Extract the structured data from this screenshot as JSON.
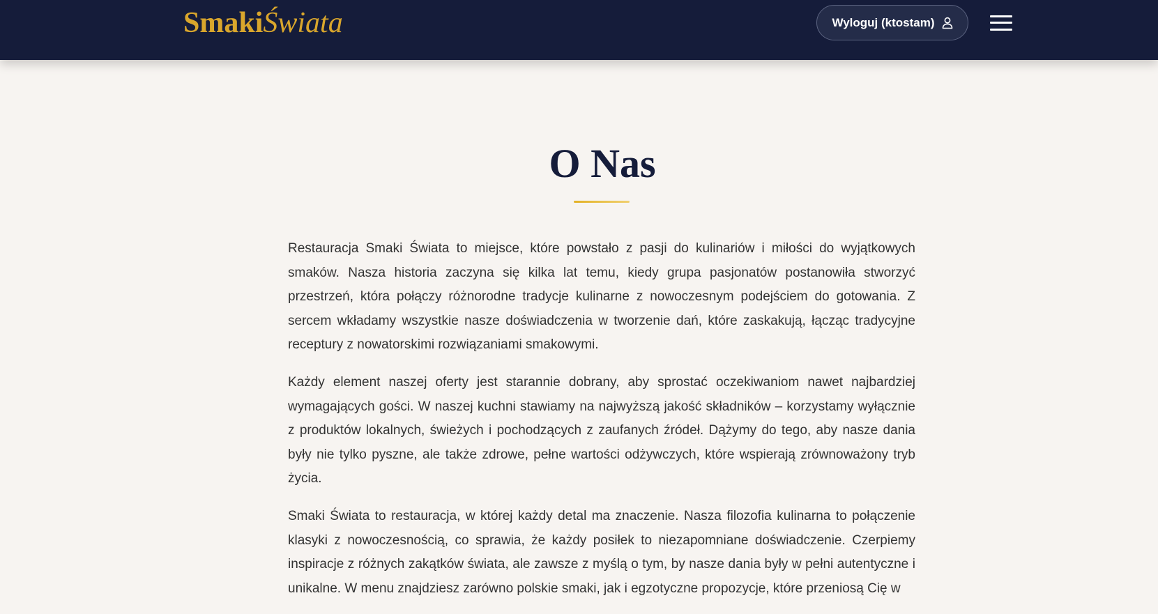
{
  "header": {
    "logo_main": "Smaki",
    "logo_accent": "Świata",
    "logout_label": "Wyloguj (ktostam)",
    "logout_icon": "user-icon",
    "menu_icon": "hamburger-menu-icon",
    "background_color": "#151c3a",
    "accent_color": "#d9a62c"
  },
  "main": {
    "title": "O Nas",
    "paragraphs": [
      "Restauracja Smaki Świata to miejsce, które powstało z pasji do kulinariów i miłości do wyjątkowych smaków. Nasza historia zaczyna się kilka lat temu, kiedy grupa pasjonatów postanowiła stworzyć przestrzeń, która połączy różnorodne tradycje kulinarne z nowoczesnym podejściem do gotowania. Z sercem wkładamy wszystkie nasze doświadczenia w tworzenie dań, które zaskakują, łącząc tradycyjne receptury z nowatorskimi rozwiązaniami smakowymi.",
      "Każdy element naszej oferty jest starannie dobrany, aby sprostać oczekiwaniom nawet najbardziej wymagających gości. W naszej kuchni stawiamy na najwyższą jakość składników – korzystamy wyłącznie z produktów lokalnych, świeżych i pochodzących z zaufanych źródeł. Dążymy do tego, aby nasze dania były nie tylko pyszne, ale także zdrowe, pełne wartości odżywczych, które wspierają zrównoważony tryb życia.",
      "Smaki Świata to restauracja, w której każdy detal ma znaczenie. Nasza filozofia kulinarna to połączenie klasyki z nowoczesnością, co sprawia, że każdy posiłek to niezapomniane doświadczenie. Czerpiemy inspiracje z różnych zakątków świata, ale zawsze z myślą o tym, by nasze dania były w pełni autentyczne i unikalne. W menu znajdziesz zarówno polskie smaki, jak i egzotyczne propozycje, które przeniosą Cię w"
    ]
  }
}
